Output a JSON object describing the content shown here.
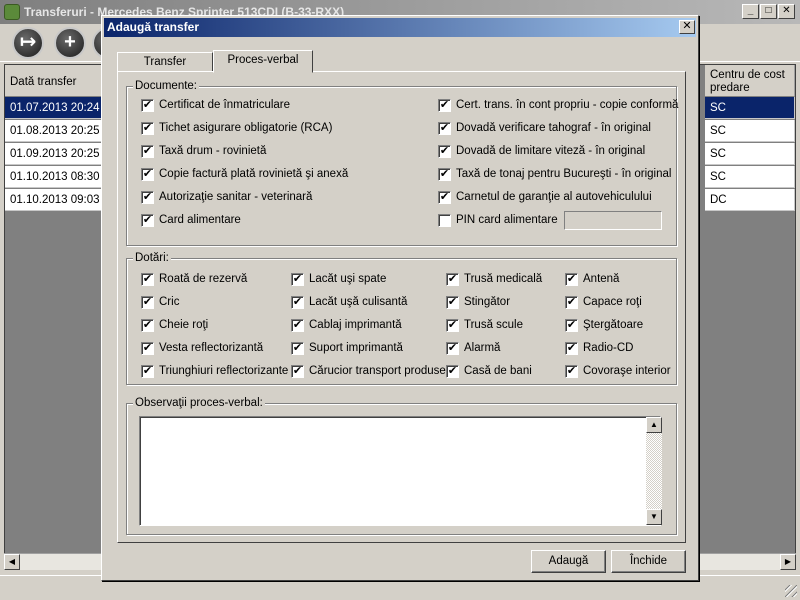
{
  "main_window": {
    "title": "Transferuri - Mercedes Benz Sprinter 513CDI (B-33-RXX)",
    "window_buttons": {
      "minimize": "_",
      "maximize": "□",
      "close": "✕"
    },
    "toolbar": {
      "buttons": [
        {
          "name": "exit",
          "glyph": "↦"
        },
        {
          "name": "add",
          "glyph": "+"
        }
      ]
    },
    "grid": {
      "columns": {
        "date": "Dată transfer",
        "centre": "Centru de cost predare"
      },
      "rows": [
        {
          "date": "01.07.2013 20:24",
          "centre": "SC",
          "selected": true
        },
        {
          "date": "01.08.2013 20:25",
          "centre": "SC",
          "selected": false
        },
        {
          "date": "01.09.2013 20:25",
          "centre": "SC",
          "selected": false
        },
        {
          "date": "01.10.2013 08:30",
          "centre": "SC",
          "selected": false
        },
        {
          "date": "01.10.2013 09:03",
          "centre": "DC",
          "selected": false
        }
      ]
    }
  },
  "dialog": {
    "title": "Adaugă transfer",
    "close_glyph": "✕",
    "tabs": [
      {
        "label": "Transfer",
        "active": false
      },
      {
        "label": "Proces-verbal",
        "active": true
      }
    ],
    "documente": {
      "title": "Documente:",
      "left": [
        {
          "label": "Certificat de înmatriculare",
          "checked": true
        },
        {
          "label": "Tichet asigurare obligatorie (RCA)",
          "checked": true
        },
        {
          "label": "Taxă drum - rovinietă",
          "checked": true
        },
        {
          "label": "Copie factură plată rovinietă şi anexă",
          "checked": true
        },
        {
          "label": "Autorizaţie sanitar - veterinară",
          "checked": true
        },
        {
          "label": "Card alimentare",
          "checked": true
        }
      ],
      "right": [
        {
          "label": "Cert. trans. în cont propriu - copie conformă",
          "checked": true
        },
        {
          "label": "Dovadă verificare tahograf - în original",
          "checked": true
        },
        {
          "label": "Dovadă de limitare viteză - în original",
          "checked": true
        },
        {
          "label": "Taxă de tonaj pentru Bucureşti - în original",
          "checked": true
        },
        {
          "label": "Carnetul de garanţie al autovehiculului",
          "checked": true
        },
        {
          "label": "PIN card alimentare",
          "checked": false
        }
      ],
      "pin_value": ""
    },
    "dotari": {
      "title": "Dotări:",
      "columns": [
        [
          {
            "label": "Roată de rezervă",
            "checked": true
          },
          {
            "label": "Cric",
            "checked": true
          },
          {
            "label": "Cheie roţi",
            "checked": true
          },
          {
            "label": "Vesta reflectorizantă",
            "checked": true
          },
          {
            "label": "Triunghiuri reflectorizante",
            "checked": true
          }
        ],
        [
          {
            "label": "Lacăt uşi spate",
            "checked": true
          },
          {
            "label": "Lacăt uşă culisantă",
            "checked": true
          },
          {
            "label": "Cablaj imprimantă",
            "checked": true
          },
          {
            "label": "Suport imprimantă",
            "checked": true
          },
          {
            "label": "Cărucior transport produse",
            "checked": true
          }
        ],
        [
          {
            "label": "Trusă medicală",
            "checked": true
          },
          {
            "label": "Stingător",
            "checked": true
          },
          {
            "label": "Trusă scule",
            "checked": true
          },
          {
            "label": "Alarmă",
            "checked": true
          },
          {
            "label": "Casă de bani",
            "checked": true
          }
        ],
        [
          {
            "label": "Antenă",
            "checked": true
          },
          {
            "label": "Capace roţi",
            "checked": true
          },
          {
            "label": "Ştergătoare",
            "checked": true
          },
          {
            "label": "Radio-CD",
            "checked": true
          },
          {
            "label": "Covoraşe interior",
            "checked": true
          }
        ]
      ]
    },
    "observatii": {
      "title": "Observaţii proces-verbal:",
      "value": ""
    },
    "buttons": {
      "add": "Adaugă",
      "close": "Închide"
    },
    "check_glyph": "✔"
  },
  "colors": {
    "selection": "#0a246a",
    "dialog_title_start": "#0a246a",
    "dialog_title_end": "#a6caf0"
  }
}
